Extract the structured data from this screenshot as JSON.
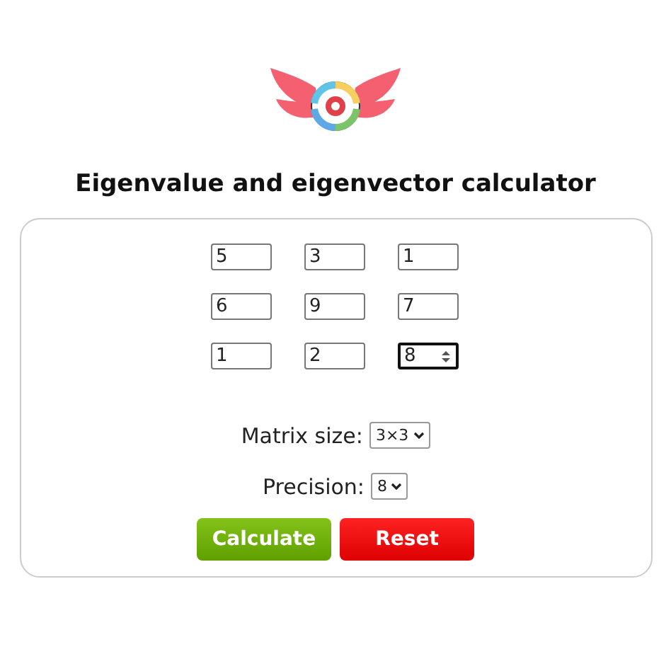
{
  "title": "Eigenvalue and eigenvector calculator",
  "matrix": [
    [
      {
        "value": "5",
        "focused": false
      },
      {
        "value": "3",
        "focused": false
      },
      {
        "value": "1",
        "focused": false
      }
    ],
    [
      {
        "value": "6",
        "focused": false
      },
      {
        "value": "9",
        "focused": false
      },
      {
        "value": "7",
        "focused": false
      }
    ],
    [
      {
        "value": "1",
        "focused": false
      },
      {
        "value": "2",
        "focused": false
      },
      {
        "value": "8",
        "focused": true
      }
    ]
  ],
  "options": [
    {
      "label": "Matrix size:",
      "value": "3×3"
    },
    {
      "label": "Precision:",
      "value": "8"
    }
  ],
  "buttons": [
    {
      "label": "Calculate",
      "kind": "primary"
    },
    {
      "label": "Reset",
      "kind": "danger"
    }
  ]
}
